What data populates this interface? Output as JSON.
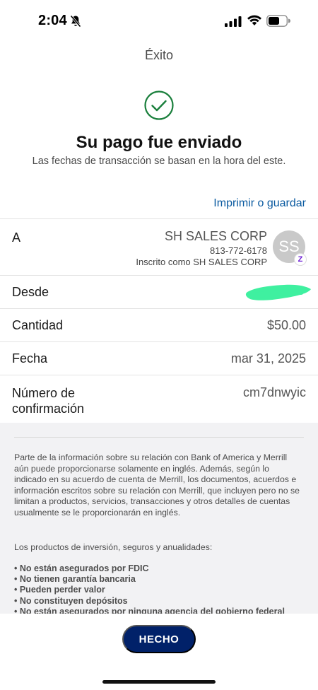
{
  "status_bar": {
    "time": "2:04"
  },
  "header": {
    "title": "Éxito",
    "headline": "Su pago fue enviado",
    "subline": "Las fechas de transacción se basan en la hora del este.",
    "print_link": "Imprimir o guardar"
  },
  "details": {
    "to": {
      "label": "A",
      "name": "SH SALES CORP",
      "phone": "813-772-6178",
      "enrolled": "Inscrito como SH SALES CORP",
      "avatar_initials": "SS",
      "badge": "Z"
    },
    "from": {
      "label": "Desde"
    },
    "amount": {
      "label": "Cantidad",
      "value": "$50.00"
    },
    "date": {
      "label": "Fecha",
      "value": "mar 31, 2025"
    },
    "confirmation": {
      "label": "Número de confirmación",
      "value": "cm7dnwyic"
    }
  },
  "disclosure": {
    "para1": "Parte de la información sobre su relación con Bank of America y Merrill aún puede proporcionarse solamente en inglés. Además, según lo indicado en su acuerdo de cuenta de Merrill, los documentos, acuerdos e información escritos sobre su relación con Merrill, que incluyen pero no se limitan a productos, servicios, transacciones y otros detalles de cuentas usualmente se le proporcionarán en inglés.",
    "para2": "Los productos de inversión, seguros y anualidades:",
    "bullets": [
      "• No están asegurados por FDIC",
      "• No tienen garantía bancaria",
      "• Pueden perder valor",
      "• No constituyen depósitos",
      "• No están asegurados por ninguna agencia del gobierno federal"
    ]
  },
  "footer": {
    "done_label": "HECHO"
  },
  "colors": {
    "brand_navy": "#012169",
    "link_blue": "#0a5aa0",
    "success_green": "#1a7f3c",
    "redaction_green": "#3ff0a0",
    "zelle_purple": "#6d1ed4"
  }
}
